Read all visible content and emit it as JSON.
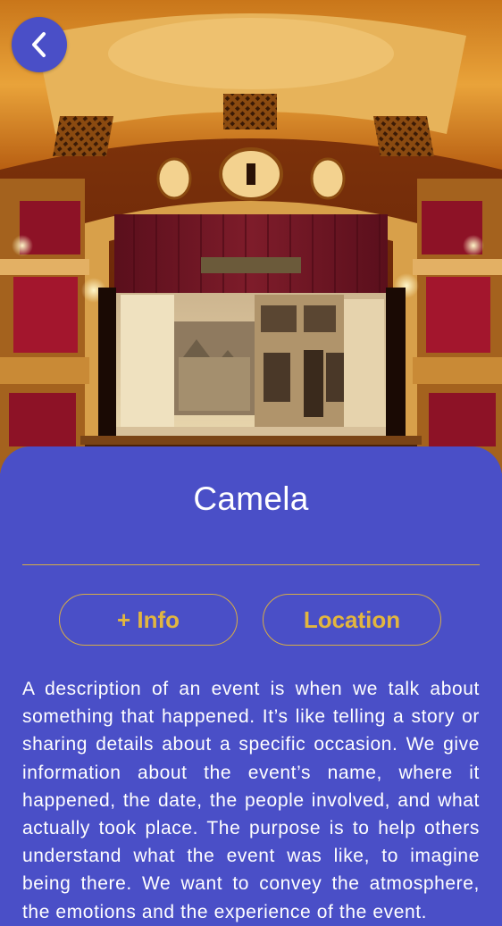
{
  "event": {
    "title": "Camela",
    "description": "A description of an event is when we talk about something that happened. It’s like telling a story or sharing details about a specific occasion. We give information about the event’s name, where it happened, the date, the people involved, and what actually took place. The purpose is to help others understand what the event was like, to imagine being there. We want to convey the atmosphere, the emotions and the experience of the event."
  },
  "buttons": {
    "info_label": "+ Info",
    "location_label": "Location"
  },
  "icons": {
    "back": "chevron-left-icon"
  },
  "colors": {
    "primary": "#4a4fc7",
    "accent": "#d7ad45",
    "text": "#ffffff"
  }
}
